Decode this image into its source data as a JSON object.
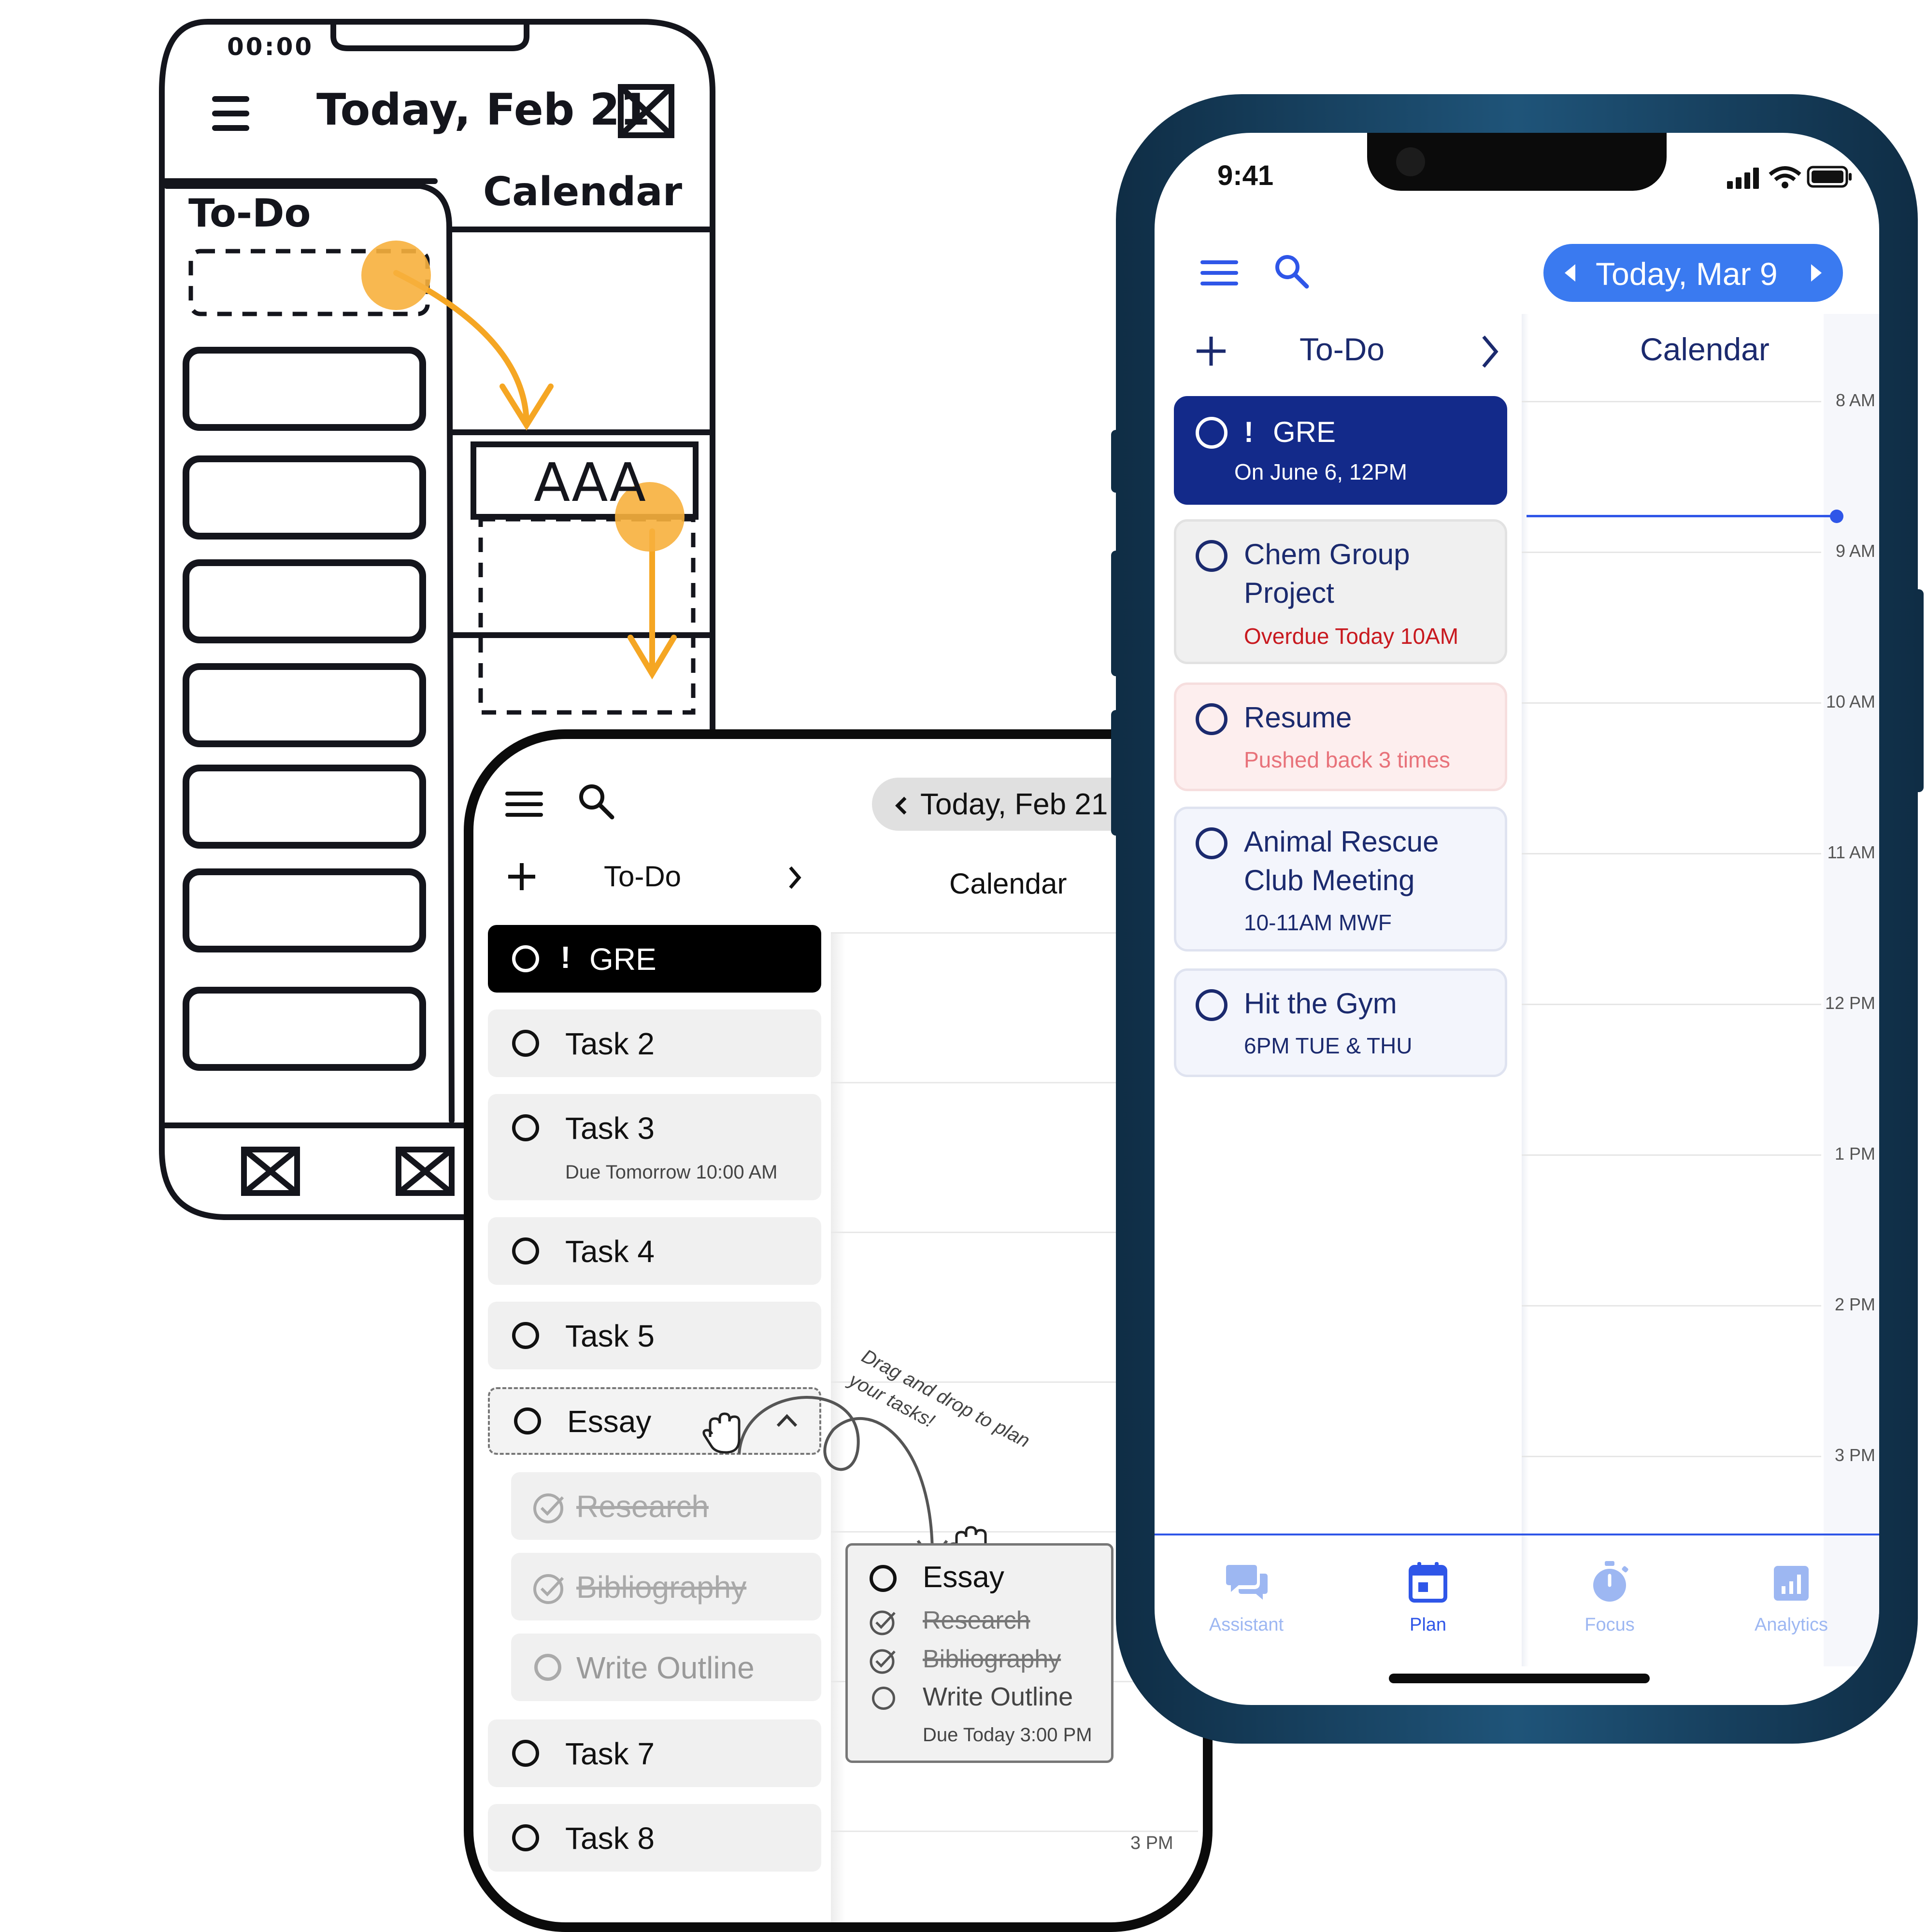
{
  "sketch": {
    "status_time": "00:00",
    "title": "Today, Feb 21",
    "todo_label": "To-Do",
    "calendar_label": "Calendar",
    "event_label": "AAA"
  },
  "mid": {
    "header": {
      "date_label": "Today, Feb 21"
    },
    "todo_header": "To-Do",
    "calendar_header": "Calendar",
    "priority_mark": "!",
    "tasks": [
      {
        "label": "GRE"
      },
      {
        "label": "Task 2"
      },
      {
        "label": "Task 3",
        "sub": "Due Tomorrow 10:00 AM"
      },
      {
        "label": "Task 4"
      },
      {
        "label": "Task 5"
      },
      {
        "label": "Essay"
      },
      {
        "label": "Research"
      },
      {
        "label": "Bibliography"
      },
      {
        "label": "Write Outline"
      },
      {
        "label": "Task 7"
      },
      {
        "label": "Task 8"
      }
    ],
    "drag_hint": "Drag and drop to plan your tasks!",
    "drop_card": {
      "title": "Essay",
      "items": [
        "Research",
        "Bibliography",
        "Write Outline"
      ],
      "due": "Due Today 3:00 PM"
    },
    "hour_label": "3 PM"
  },
  "hifi": {
    "status_time": "9:41",
    "date_label": "Today, Mar 9",
    "todo_header": "To-Do",
    "calendar_header": "Calendar",
    "priority_mark": "!",
    "tasks": [
      {
        "label": "GRE",
        "sub": "On June 6, 12PM"
      },
      {
        "label": "Chem Group",
        "label2": "Project",
        "sub": "Overdue Today 10AM"
      },
      {
        "label": "Resume",
        "sub": "Pushed back 3 times"
      },
      {
        "label": "Animal Rescue",
        "label2": "Club Meeting",
        "sub": "10-11AM MWF"
      },
      {
        "label": "Hit the Gym",
        "sub": "6PM TUE & THU"
      }
    ],
    "hours": [
      "8 AM",
      "9 AM",
      "10 AM",
      "11 AM",
      "12 PM",
      "1 PM",
      "2 PM",
      "3 PM"
    ],
    "tabs": [
      {
        "label": "Assistant",
        "icon": "chat-icon"
      },
      {
        "label": "Plan",
        "icon": "calendar-icon"
      },
      {
        "label": "Focus",
        "icon": "stopwatch-icon"
      },
      {
        "label": "Analytics",
        "icon": "chart-icon"
      }
    ],
    "colors": {
      "primary": "#132a8a",
      "accent": "#2f6ef0",
      "overdue": "#c8191f",
      "pushed": "#e8727a",
      "tab_inactive": "#9db7f2"
    }
  }
}
